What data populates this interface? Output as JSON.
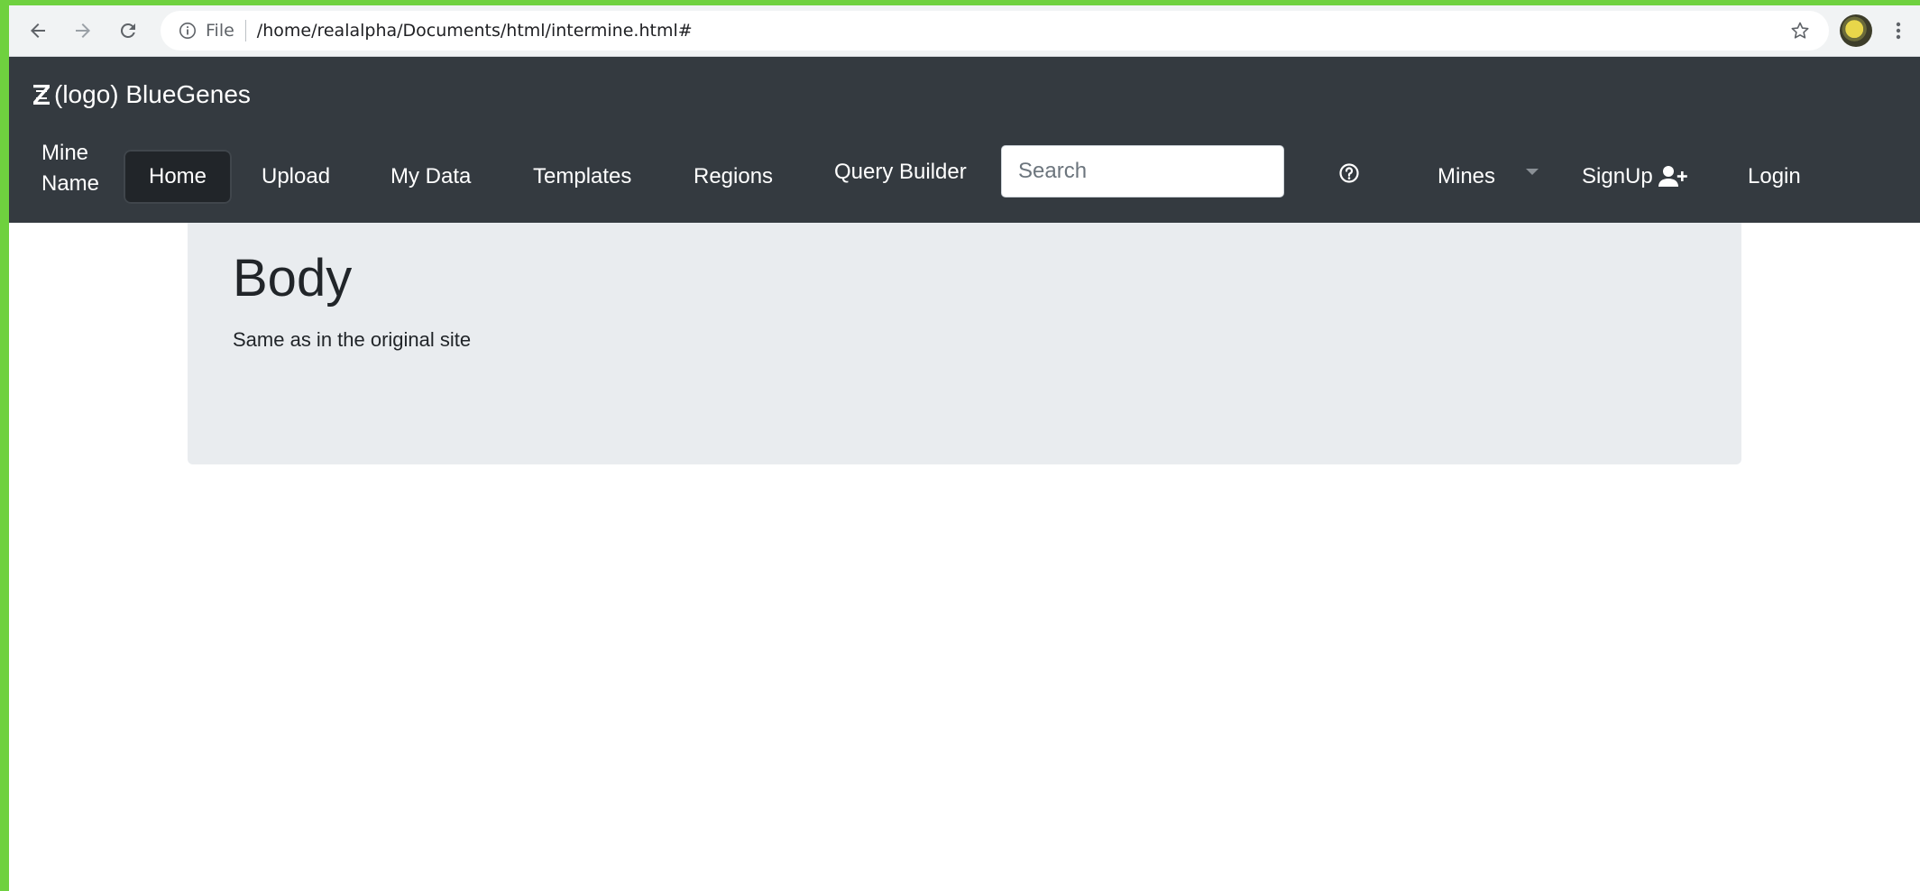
{
  "browser": {
    "file_label": "File",
    "url": "/home/realalpha/Documents/html/intermine.html#"
  },
  "navbar": {
    "brand": "(logo) BlueGenes",
    "mine_name": "Mine Name",
    "links": {
      "home": "Home",
      "upload": "Upload",
      "my_data": "My Data",
      "templates": "Templates",
      "regions": "Regions",
      "query_builder": "Query Builder"
    },
    "search_placeholder": "Search",
    "mines": "Mines",
    "signup": "SignUp",
    "login": "Login"
  },
  "jumbotron": {
    "heading": "Body",
    "text": "Same as in the original site"
  },
  "colors": {
    "navbar_bg": "#343a40",
    "active_link_bg": "#212529",
    "jumbotron_bg": "#e9ecef",
    "desktop_bg": "#6fd13f"
  }
}
